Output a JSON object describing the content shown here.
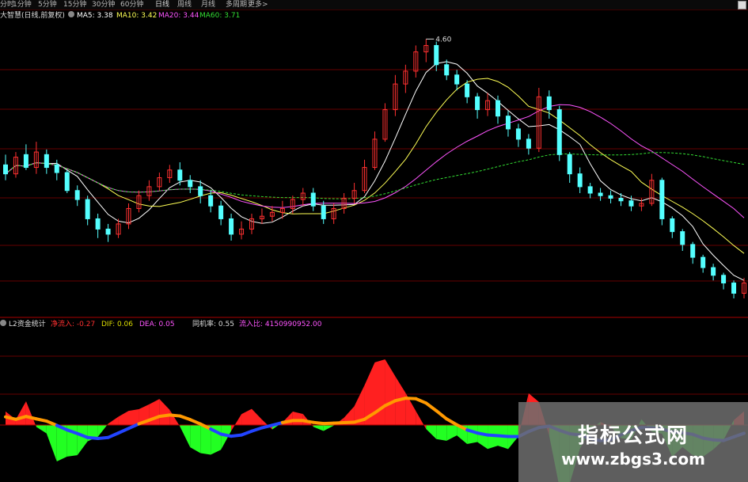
{
  "toolbar": {
    "tabs": [
      {
        "label": "分时"
      },
      {
        "label": "1分钟"
      },
      {
        "label": "5分钟"
      },
      {
        "label": "15分钟"
      },
      {
        "label": "30分钟"
      },
      {
        "label": "60分钟"
      },
      {
        "label": "日线"
      },
      {
        "label": "周线"
      },
      {
        "label": "月线"
      },
      {
        "label": "多周期"
      },
      {
        "label": "更多>"
      }
    ],
    "active_index": 6
  },
  "main_legend": {
    "title": "大智慧(日线,前复权)",
    "ma5": "MA5: 3.38",
    "ma10": "MA10: 3.42",
    "ma20": "MA20: 3.44",
    "ma60": "MA60: 3.71"
  },
  "price_annotation": "4.60",
  "sub_legend": {
    "title": "L2资金统计",
    "net_inflow": "净流入: -0.27",
    "dif": "DIF: 0.06",
    "dea": "DEA: 0.05",
    "balance": "同机率: 0.55",
    "inflow_ratio": "流入比: 4150990952.00"
  },
  "watermark": {
    "title": "指标公式网",
    "url": "www.zbgs3.com"
  },
  "colors": {
    "up_candle": "#ff3030",
    "down_candle": "#54ffff",
    "ma5": "#ffffff",
    "ma10": "#ffff55",
    "ma20": "#ff55ff",
    "ma60": "#33dd33",
    "area_up": "#ff2020",
    "area_down": "#22ff22",
    "line_orange": "#ff9900",
    "line_blue": "#2244ff",
    "grid": "#660000"
  },
  "candles": [
    [
      0,
      3.62,
      3.55,
      3.7,
      3.5
    ],
    [
      1,
      3.55,
      3.68,
      3.72,
      3.52
    ],
    [
      2,
      3.7,
      3.6,
      3.78,
      3.58
    ],
    [
      3,
      3.6,
      3.72,
      3.8,
      3.55
    ],
    [
      4,
      3.7,
      3.6,
      3.74,
      3.55
    ],
    [
      5,
      3.62,
      3.56,
      3.66,
      3.5
    ],
    [
      6,
      3.56,
      3.42,
      3.58,
      3.4
    ],
    [
      7,
      3.42,
      3.35,
      3.46,
      3.3
    ],
    [
      8,
      3.35,
      3.2,
      3.38,
      3.15
    ],
    [
      9,
      3.2,
      3.12,
      3.24,
      3.05
    ],
    [
      10,
      3.12,
      3.08,
      3.16,
      3.02
    ],
    [
      11,
      3.08,
      3.16,
      3.2,
      3.05
    ],
    [
      12,
      3.16,
      3.28,
      3.32,
      3.12
    ],
    [
      13,
      3.28,
      3.38,
      3.42,
      3.25
    ],
    [
      14,
      3.38,
      3.45,
      3.5,
      3.34
    ],
    [
      15,
      3.45,
      3.52,
      3.56,
      3.42
    ],
    [
      16,
      3.52,
      3.58,
      3.62,
      3.48
    ],
    [
      17,
      3.58,
      3.5,
      3.64,
      3.46
    ],
    [
      18,
      3.5,
      3.45,
      3.54,
      3.4
    ],
    [
      19,
      3.45,
      3.38,
      3.5,
      3.32
    ],
    [
      20,
      3.38,
      3.3,
      3.42,
      3.25
    ],
    [
      21,
      3.3,
      3.2,
      3.34,
      3.15
    ],
    [
      22,
      3.2,
      3.08,
      3.24,
      3.03
    ],
    [
      23,
      3.08,
      3.12,
      3.18,
      3.04
    ],
    [
      24,
      3.12,
      3.2,
      3.24,
      3.08
    ],
    [
      25,
      3.2,
      3.22,
      3.28,
      3.16
    ],
    [
      26,
      3.22,
      3.25,
      3.3,
      3.18
    ],
    [
      27,
      3.25,
      3.28,
      3.34,
      3.2
    ],
    [
      28,
      3.28,
      3.35,
      3.38,
      3.24
    ],
    [
      29,
      3.35,
      3.4,
      3.44,
      3.3
    ],
    [
      30,
      3.4,
      3.3,
      3.44,
      3.26
    ],
    [
      31,
      3.3,
      3.2,
      3.34,
      3.16
    ],
    [
      32,
      3.2,
      3.28,
      3.32,
      3.16
    ],
    [
      33,
      3.28,
      3.36,
      3.4,
      3.24
    ],
    [
      34,
      3.36,
      3.42,
      3.48,
      3.32
    ],
    [
      35,
      3.42,
      3.6,
      3.66,
      3.4
    ],
    [
      36,
      3.6,
      3.82,
      3.88,
      3.58
    ],
    [
      37,
      3.82,
      4.05,
      4.1,
      3.8
    ],
    [
      38,
      4.05,
      4.25,
      4.32,
      4.0
    ],
    [
      39,
      4.25,
      4.35,
      4.4,
      4.18
    ],
    [
      40,
      4.35,
      4.5,
      4.55,
      4.3
    ],
    [
      41,
      4.5,
      4.55,
      4.6,
      4.42
    ],
    [
      42,
      4.55,
      4.4,
      4.58,
      4.35
    ],
    [
      43,
      4.4,
      4.32,
      4.44,
      4.28
    ],
    [
      44,
      4.32,
      4.25,
      4.36,
      4.2
    ],
    [
      45,
      4.25,
      4.15,
      4.28,
      4.1
    ],
    [
      46,
      4.15,
      4.05,
      4.18,
      3.98
    ],
    [
      47,
      4.05,
      4.12,
      4.18,
      4.0
    ],
    [
      48,
      4.12,
      4.0,
      4.16,
      3.94
    ],
    [
      49,
      4.0,
      3.9,
      4.04,
      3.84
    ],
    [
      50,
      3.9,
      3.82,
      3.94,
      3.76
    ],
    [
      51,
      3.82,
      3.75,
      3.86,
      3.7
    ],
    [
      52,
      3.75,
      4.15,
      4.22,
      3.72
    ],
    [
      53,
      4.15,
      4.05,
      4.2,
      3.98
    ],
    [
      54,
      4.05,
      3.7,
      4.08,
      3.65
    ],
    [
      55,
      3.7,
      3.55,
      3.72,
      3.48
    ],
    [
      56,
      3.55,
      3.45,
      3.6,
      3.4
    ],
    [
      57,
      3.45,
      3.4,
      3.48,
      3.36
    ],
    [
      58,
      3.4,
      3.38,
      3.44,
      3.34
    ],
    [
      59,
      3.38,
      3.36,
      3.42,
      3.32
    ],
    [
      60,
      3.36,
      3.34,
      3.4,
      3.3
    ],
    [
      61,
      3.34,
      3.3,
      3.38,
      3.26
    ],
    [
      62,
      3.3,
      3.32,
      3.36,
      3.26
    ],
    [
      63,
      3.32,
      3.5,
      3.55,
      3.3
    ],
    [
      64,
      3.5,
      3.2,
      3.52,
      3.15
    ],
    [
      65,
      3.2,
      3.1,
      3.22,
      3.05
    ],
    [
      66,
      3.1,
      3.0,
      3.12,
      2.95
    ],
    [
      67,
      3.0,
      2.9,
      3.02,
      2.85
    ],
    [
      68,
      2.9,
      2.82,
      2.92,
      2.78
    ],
    [
      69,
      2.82,
      2.76,
      2.85,
      2.72
    ],
    [
      70,
      2.76,
      2.7,
      2.78,
      2.65
    ],
    [
      71,
      2.7,
      2.62,
      2.72,
      2.58
    ],
    [
      72,
      2.62,
      2.7,
      2.74,
      2.58
    ]
  ]
}
